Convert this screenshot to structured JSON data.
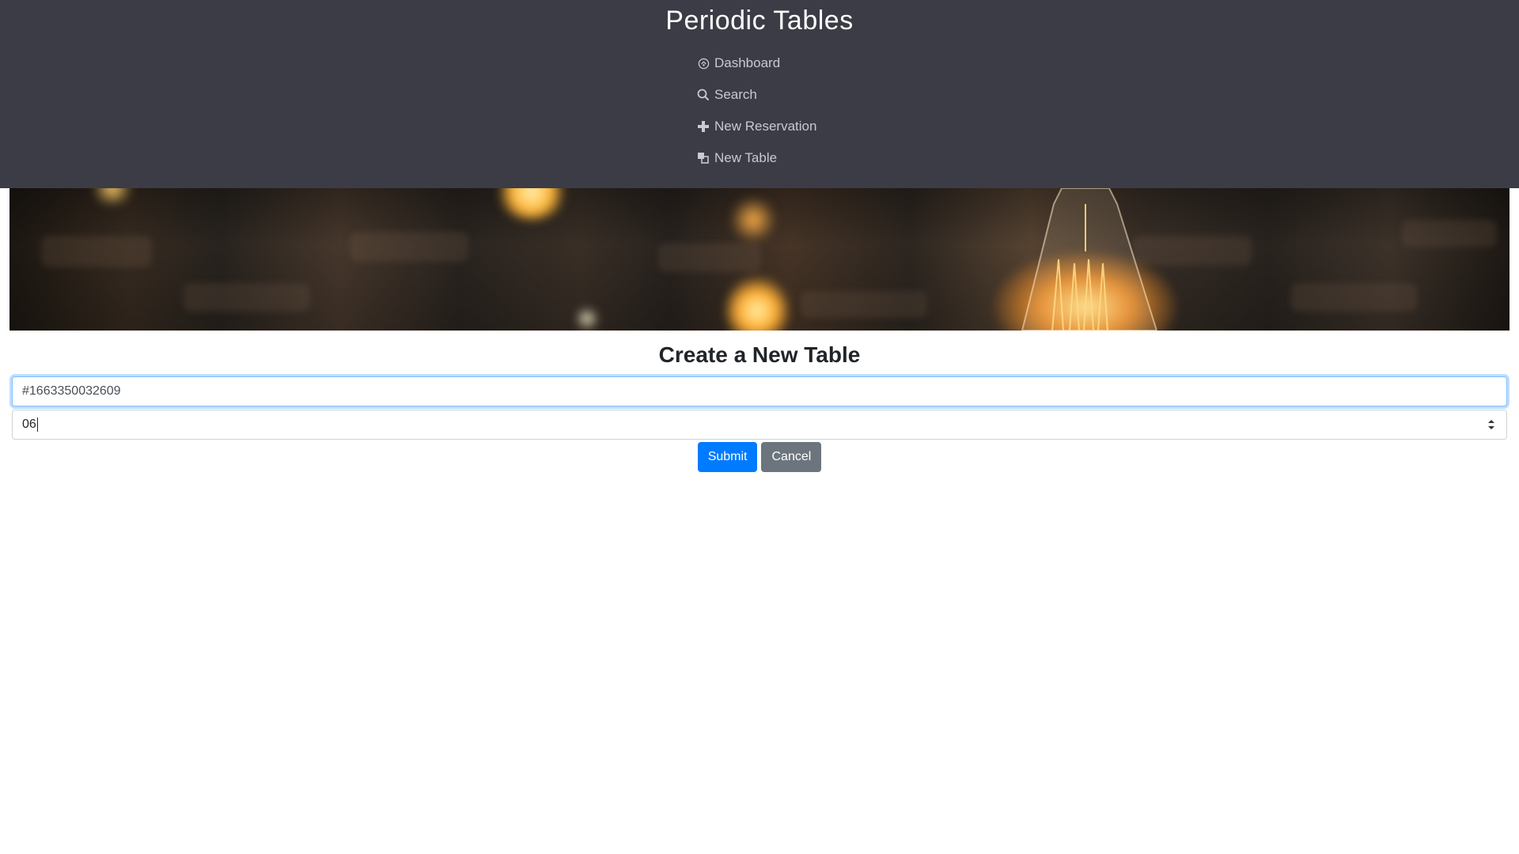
{
  "header": {
    "title": "Periodic Tables"
  },
  "nav": {
    "items": [
      {
        "label": "Dashboard",
        "icon": "dashboard-icon"
      },
      {
        "label": "Search",
        "icon": "search-icon"
      },
      {
        "label": "New Reservation",
        "icon": "plus-icon"
      },
      {
        "label": "New Table",
        "icon": "table-icon"
      }
    ]
  },
  "form": {
    "title": "Create a New Table",
    "table_name_value": "#1663350032609",
    "capacity_value": "06",
    "submit_label": "Submit",
    "cancel_label": "Cancel"
  },
  "colors": {
    "header_bg": "#3b3c46",
    "primary": "#007bff",
    "secondary": "#6c757d"
  }
}
